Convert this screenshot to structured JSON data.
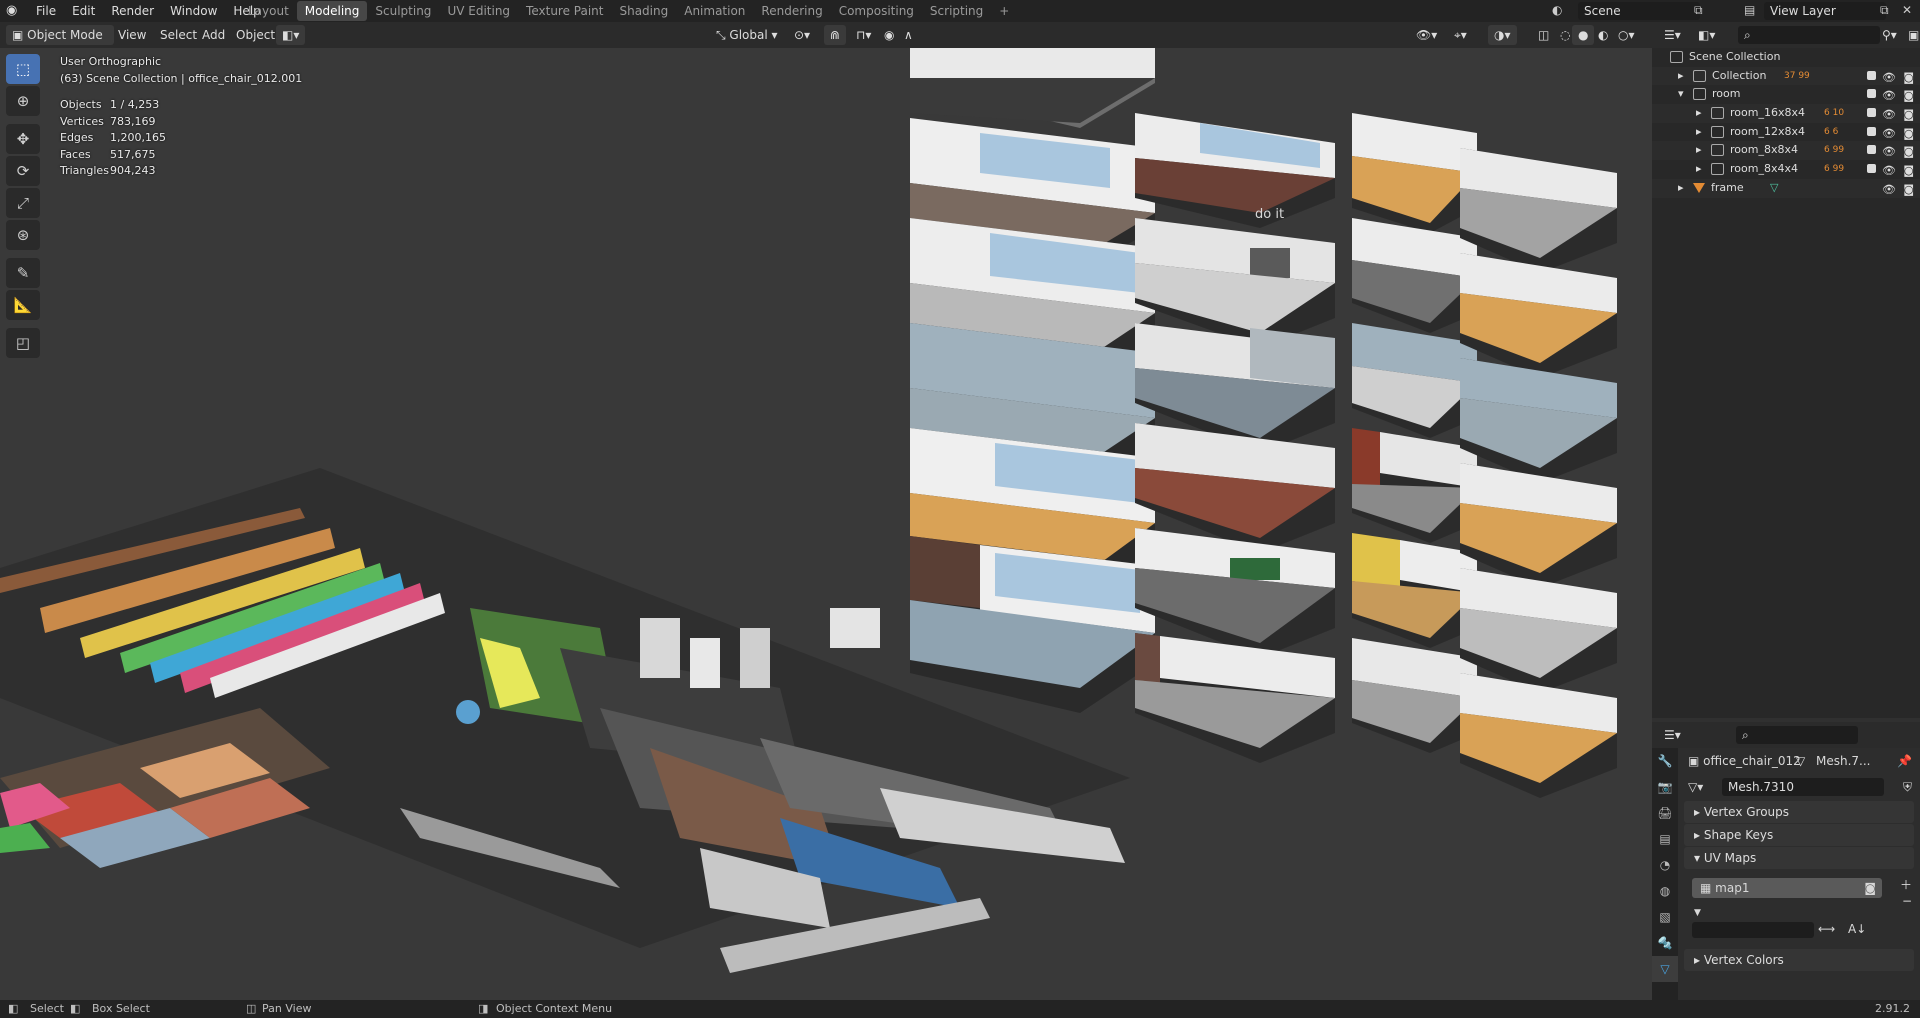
{
  "menubar": {
    "menus": [
      "File",
      "Edit",
      "Render",
      "Window",
      "Help"
    ],
    "workspaces": [
      "Layout",
      "Modeling",
      "Sculpting",
      "UV Editing",
      "Texture Paint",
      "Shading",
      "Animation",
      "Rendering",
      "Compositing",
      "Scripting"
    ],
    "active_workspace": "Modeling",
    "add_tab": "+",
    "scene": "Scene",
    "view_layer": "View Layer"
  },
  "viewport_header": {
    "mode": "Object Mode",
    "menus": [
      "View",
      "Select",
      "Add",
      "Object"
    ],
    "orientation": "Global"
  },
  "overlay": {
    "view_name": "User Orthographic",
    "context": "(63) Scene Collection | office_chair_012.001",
    "stats": [
      {
        "label": "Objects",
        "value": "1 / 4,253"
      },
      {
        "label": "Vertices",
        "value": "783,169"
      },
      {
        "label": "Edges",
        "value": "1,200,165"
      },
      {
        "label": "Faces",
        "value": "517,675"
      },
      {
        "label": "Triangles",
        "value": "904,243"
      }
    ],
    "wall_text": "do it"
  },
  "outliner": {
    "root": "Scene Collection",
    "rows": [
      {
        "name": "Collection",
        "counts": "37 99",
        "depth": 1,
        "expand": "▸"
      },
      {
        "name": "room",
        "counts": "",
        "depth": 1,
        "expand": "▾"
      },
      {
        "name": "room_16x8x4",
        "counts": "6 10",
        "depth": 2,
        "expand": "▸"
      },
      {
        "name": "room_12x8x4",
        "counts": "6 6",
        "depth": 2,
        "expand": "▸"
      },
      {
        "name": "room_8x8x4",
        "counts": "6 99",
        "depth": 2,
        "expand": "▸"
      },
      {
        "name": "room_8x4x4",
        "counts": "6 99",
        "depth": 2,
        "expand": "▸"
      },
      {
        "name": "frame",
        "counts": "",
        "depth": 1,
        "expand": "▸"
      }
    ]
  },
  "properties": {
    "object_name": "office_chair_012",
    "mesh_short": "Mesh.7...",
    "mesh_name": "Mesh.7310",
    "panels": [
      "Vertex Groups",
      "Shape Keys",
      "UV Maps"
    ],
    "uv_map": "map1",
    "last_panel": "Vertex Colors"
  },
  "statusbar": {
    "select": "Select",
    "box_select": "Box Select",
    "pan": "Pan View",
    "context_menu": "Object Context Menu",
    "version": "2.91.2"
  },
  "colors": {
    "accent": "#4772b3",
    "orange": "#e38b34",
    "viewport_bg": "#393939"
  }
}
